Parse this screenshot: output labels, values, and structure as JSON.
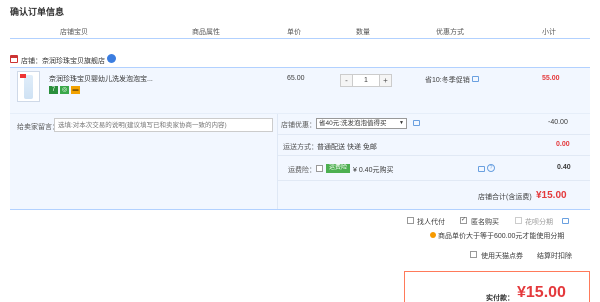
{
  "page_title": "确认订单信息",
  "columns": [
    "店铺宝贝",
    "商品属性",
    "单价",
    "数量",
    "优惠方式",
    "小计"
  ],
  "shop": {
    "label": "店铺：奈润珍珠宝贝旗舰店"
  },
  "item": {
    "name": "奈润珍珠宝贝婴幼儿洗发泡泡宝...",
    "badges": [
      "7",
      "◎",
      "▬"
    ],
    "price": "65.00",
    "quantity": "1",
    "minus": "-",
    "plus": "+",
    "promo": "省10:冬季促销",
    "subtotal": "55.00"
  },
  "message": {
    "label": "给卖家留言：",
    "placeholder": "选填:对本次交易的说明(建议填写已和卖家协商一致的内容)"
  },
  "store_discount": {
    "label": "店铺优惠：",
    "selected": "省40元:洗发泡泡值得买",
    "amount": "-40.00"
  },
  "shipping": {
    "label": "运送方式：",
    "method": "普通配送 快递 免邮",
    "amount": "0.00"
  },
  "insurance": {
    "label": "运费险：",
    "tag": "运费险",
    "text": "¥ 0.40元购买",
    "amount": "0.40"
  },
  "store_total": {
    "label": "店铺合计(含运费)",
    "value": "¥15.00"
  },
  "options": {
    "pay_for_other": "找人代付",
    "anonymous": "匿名购买",
    "installment": "花呗分期",
    "installment_note": "商品单价大于等于600.00元才能使用分期"
  },
  "tmall_points": {
    "label": "使用天猫点券",
    "deduct": "结算时扣除"
  },
  "final": {
    "label": "实付款：",
    "value": "¥15.00"
  },
  "colors": {
    "accent_red": "#e4393c",
    "header_line": "#b2d1ff",
    "row_bg": "#f2f7ff"
  }
}
